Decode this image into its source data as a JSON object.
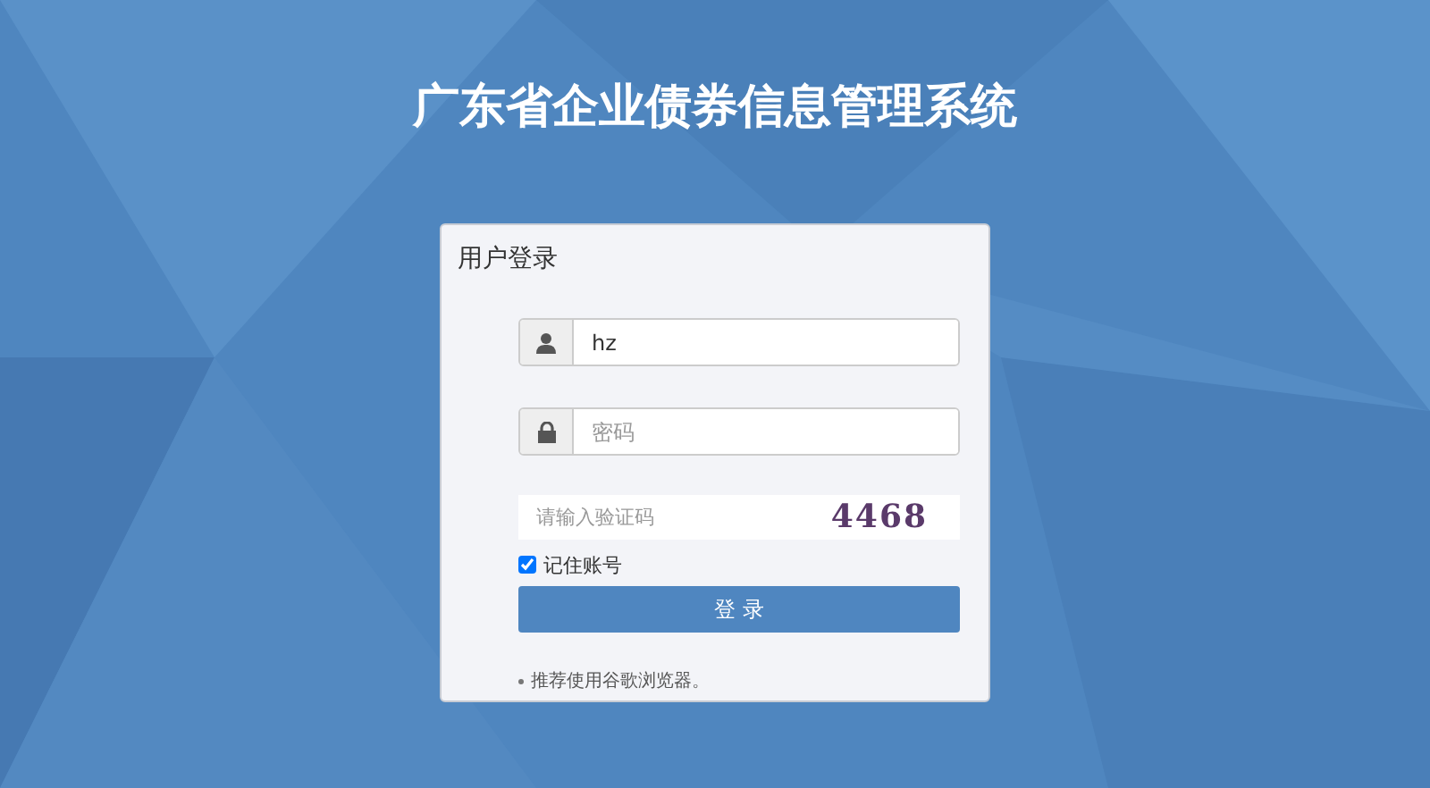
{
  "title": "广东省企业债券信息管理系统",
  "login": {
    "heading": "用户登录",
    "username": {
      "value": "hz"
    },
    "password": {
      "placeholder": "密码"
    },
    "captcha": {
      "placeholder": "请输入验证码",
      "code": "4468"
    },
    "remember": {
      "label": "记住账号",
      "checked": true
    },
    "submit": "登 录",
    "note": "推荐使用谷歌浏览器。"
  }
}
